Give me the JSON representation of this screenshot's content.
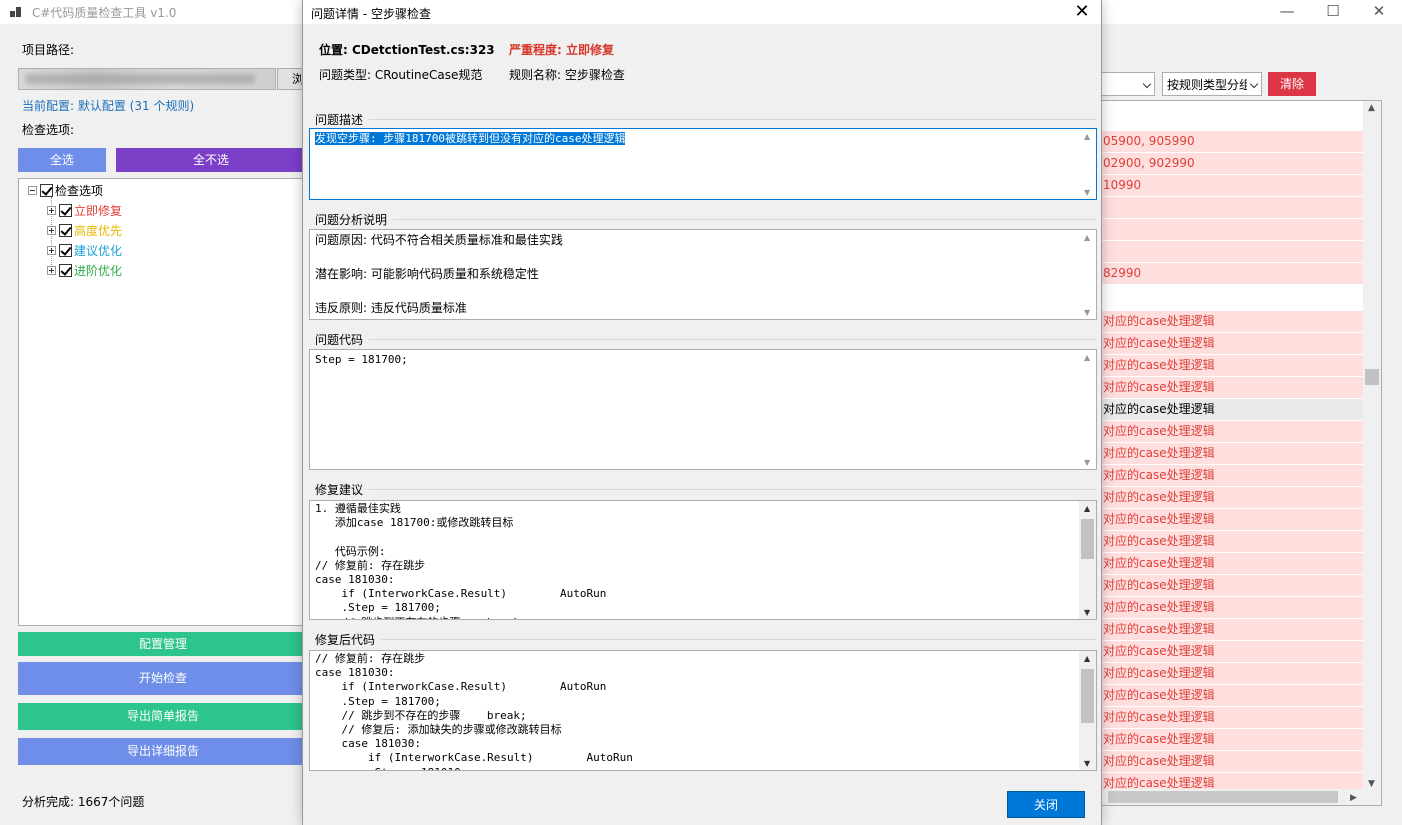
{
  "main": {
    "title": "C#代码质量检查工具 v1.0",
    "controls": {
      "minimize": "—",
      "maximize": "☐",
      "close": "✕"
    },
    "project_path_label": "项目路径:",
    "browse_label": "浏",
    "current_config": "当前配置: 默认配置 (31 个规则)",
    "options_label": "检查选项:",
    "select_all": "全选",
    "deselect_all": "全不选",
    "tree": {
      "root": "检查选项",
      "items": [
        {
          "label": "立即修复",
          "color": "#e0403a"
        },
        {
          "label": "高度优先",
          "color": "#e6b800"
        },
        {
          "label": "建议优化",
          "color": "#1a9fd6"
        },
        {
          "label": "进阶优化",
          "color": "#2eaa4a"
        }
      ]
    },
    "buttons": {
      "config": "配置管理",
      "start": "开始检查",
      "export_simple": "导出简单报告",
      "export_detail": "导出详细报告"
    },
    "status": "分析完成: 1667个问题",
    "group_by": "按规则类型分组",
    "clear": "清除",
    "results": [
      "",
      "05900, 905990",
      "02900, 902990",
      "10990",
      "",
      "",
      "",
      "82990",
      "",
      "对应的case处理逻辑",
      "对应的case处理逻辑",
      "对应的case处理逻辑",
      "对应的case处理逻辑",
      "对应的case处理逻辑",
      "对应的case处理逻辑",
      "对应的case处理逻辑",
      "对应的case处理逻辑",
      "对应的case处理逻辑",
      "对应的case处理逻辑",
      "对应的case处理逻辑",
      "对应的case处理逻辑",
      "对应的case处理逻辑",
      "对应的case处理逻辑",
      "对应的case处理逻辑",
      "对应的case处理逻辑",
      "对应的case处理逻辑",
      "对应的case处理逻辑",
      "对应的case处理逻辑",
      "对应的case处理逻辑",
      "对应的case处理逻辑",
      "对应的case处理逻辑",
      "对应的case处理逻辑"
    ]
  },
  "dialog": {
    "title": "问题详情 - 空步骤检查",
    "close_x": "✕",
    "location": "位置: CDetctionTest.cs:323",
    "severity": "严重程度: 立即修复",
    "issue_type": "问题类型: CRoutineCase规范",
    "rule_name": "规则名称: 空步骤检查",
    "sections": {
      "description": {
        "label": "问题描述",
        "text": "发现空步骤: 步骤181700被跳转到但没有对应的case处理逻辑"
      },
      "analysis": {
        "label": "问题分析说明",
        "text": "问题原因: 代码不符合相关质量标准和最佳实践\n\n潜在影响: 可能影响代码质量和系统稳定性\n\n违反原则: 违反代码质量标准"
      },
      "code": {
        "label": "问题代码",
        "text": "Step = 181700;"
      },
      "suggestion": {
        "label": "修复建议",
        "text": "1. 遵循最佳实践\n   添加case 181700:或修改跳转目标\n\n   代码示例:\n// 修复前: 存在跳步\ncase 181030:\n    if (InterworkCase.Result)        AutoRun\n    .Step = 181700;\n    // 跳步到不存在的步骤    break;"
      },
      "fixed": {
        "label": "修复后代码",
        "text": "// 修复前: 存在跳步\ncase 181030:\n    if (InterworkCase.Result)        AutoRun\n    .Step = 181700;\n    // 跳步到不存在的步骤    break;\n    // 修复后: 添加缺失的步骤或修改跳转目标\n    case 181030:\n        if (InterworkCase.Result)        AutoRun\n        .Step = 181010;"
      }
    },
    "close_button": "关闭"
  }
}
